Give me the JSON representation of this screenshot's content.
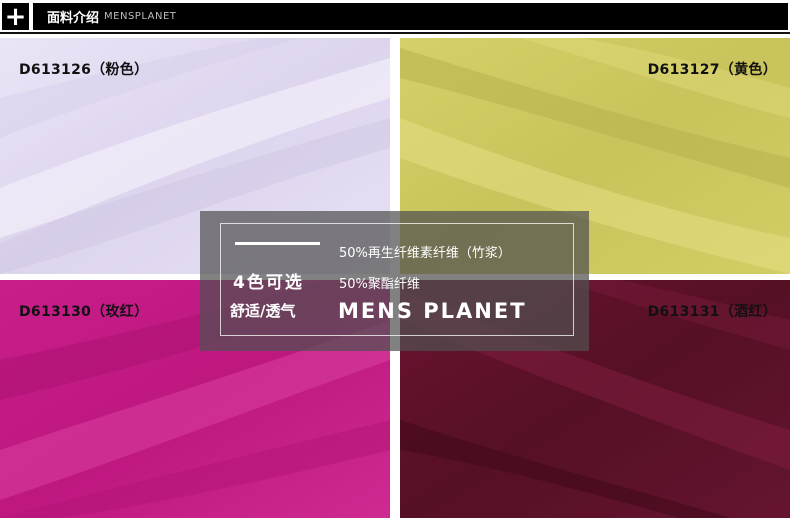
{
  "header": {
    "title_cn": "面料介绍",
    "title_en": "MENSPLANET"
  },
  "swatches": [
    {
      "label": "D613126（粉色）",
      "color": "#e4dcf1"
    },
    {
      "label": "D613127（黄色）",
      "color": "#cdc763"
    },
    {
      "label": "D613130（玫红）",
      "color": "#c51c86"
    },
    {
      "label": "D613131（酒红）",
      "color": "#5a0d25"
    }
  ],
  "overlay": {
    "colors_text": "4色可选",
    "feature_text": "舒适/透气",
    "composition_1": "50%再生纤维素纤维（竹浆）",
    "composition_2": "50%聚酯纤维",
    "brand": "MENS PLANET"
  }
}
